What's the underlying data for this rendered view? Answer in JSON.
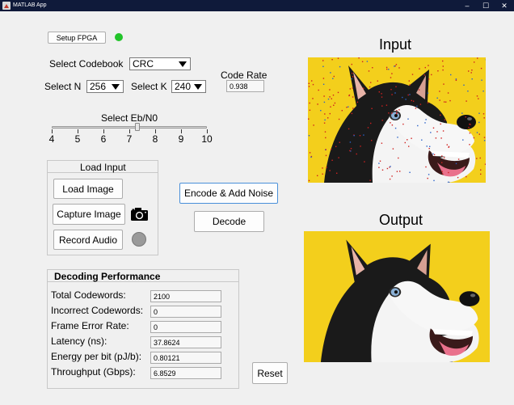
{
  "window": {
    "title": "MATLAB App",
    "minimize": "–",
    "maximize": "☐",
    "close": "✕"
  },
  "fpga": {
    "setup_label": "Setup FPGA",
    "lamp_color": "#22c42a"
  },
  "codebook": {
    "label": "Select Codebook",
    "value": "CRC"
  },
  "n": {
    "label": "Select N",
    "value": "256"
  },
  "k": {
    "label": "Select K",
    "value": "240"
  },
  "code_rate": {
    "label": "Code Rate",
    "value": "0.938"
  },
  "ebn0": {
    "label": "Select Eb/N0",
    "ticks": [
      "4",
      "5",
      "6",
      "7",
      "8",
      "9",
      "10"
    ],
    "min": 4,
    "max": 10,
    "value": 7.3
  },
  "load_input": {
    "title": "Load Input",
    "load_image": "Load Image",
    "capture_image": "Capture Image",
    "record_audio": "Record Audio",
    "audio_lamp_color": "#9a9a9a"
  },
  "actions": {
    "encode_label": "Encode & Add Noise",
    "decode_label": "Decode",
    "reset_label": "Reset"
  },
  "images": {
    "input_title": "Input",
    "output_title": "Output",
    "background_color": "#f3cf1c"
  },
  "performance": {
    "title": "Decoding Performance",
    "rows": [
      {
        "label": "Total Codewords:",
        "value": "2100"
      },
      {
        "label": "Incorrect Codewords:",
        "value": "0"
      },
      {
        "label": "Frame Error Rate:",
        "value": "0"
      },
      {
        "label": "Latency (ns):",
        "value": "37.8624"
      },
      {
        "label": "Energy per bit (pJ/b):",
        "value": "0.80121"
      },
      {
        "label": "Throughput (Gbps):",
        "value": "6.8529"
      }
    ]
  }
}
